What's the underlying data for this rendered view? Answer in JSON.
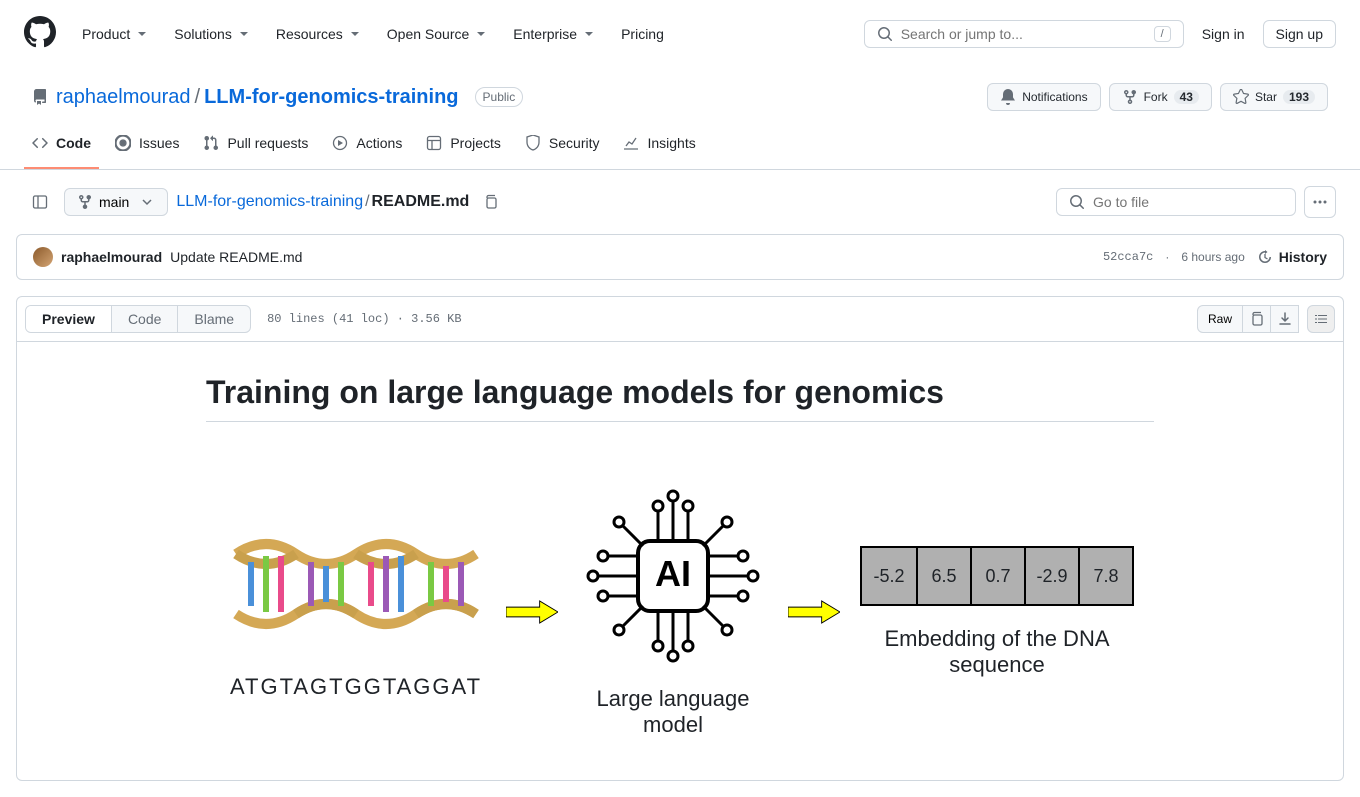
{
  "header": {
    "nav": {
      "product": "Product",
      "solutions": "Solutions",
      "resources": "Resources",
      "opensource": "Open Source",
      "enterprise": "Enterprise",
      "pricing": "Pricing"
    },
    "search_placeholder": "Search or jump to...",
    "search_kbd": "/",
    "signin": "Sign in",
    "signup": "Sign up"
  },
  "repo": {
    "owner": "raphaelmourad",
    "name": "LLM-for-genomics-training",
    "visibility": "Public",
    "notifications_label": "Notifications",
    "fork_label": "Fork",
    "fork_count": "43",
    "star_label": "Star",
    "star_count": "193"
  },
  "tabs": {
    "code": "Code",
    "issues": "Issues",
    "pull": "Pull requests",
    "actions": "Actions",
    "projects": "Projects",
    "security": "Security",
    "insights": "Insights"
  },
  "file": {
    "branch": "main",
    "repo_link": "LLM-for-genomics-training",
    "filename": "README.md",
    "gotofile_placeholder": "Go to file"
  },
  "commit": {
    "author": "raphaelmourad",
    "message": "Update README.md",
    "hash": "52cca7c",
    "sep": "·",
    "time": "6 hours ago",
    "history": "History"
  },
  "toolbar": {
    "preview": "Preview",
    "code": "Code",
    "blame": "Blame",
    "meta": "80 lines (41 loc) · 3.56 KB",
    "raw": "Raw"
  },
  "readme": {
    "h1": "Training on large language models for genomics",
    "dna_seq": "ATGTAGTGGTAGGAT",
    "llm_label": "Large language model",
    "embedding_label": "Embedding of the DNA sequence",
    "embedding_values": [
      "-5.2",
      "6.5",
      "0.7",
      "-2.9",
      "7.8"
    ]
  }
}
